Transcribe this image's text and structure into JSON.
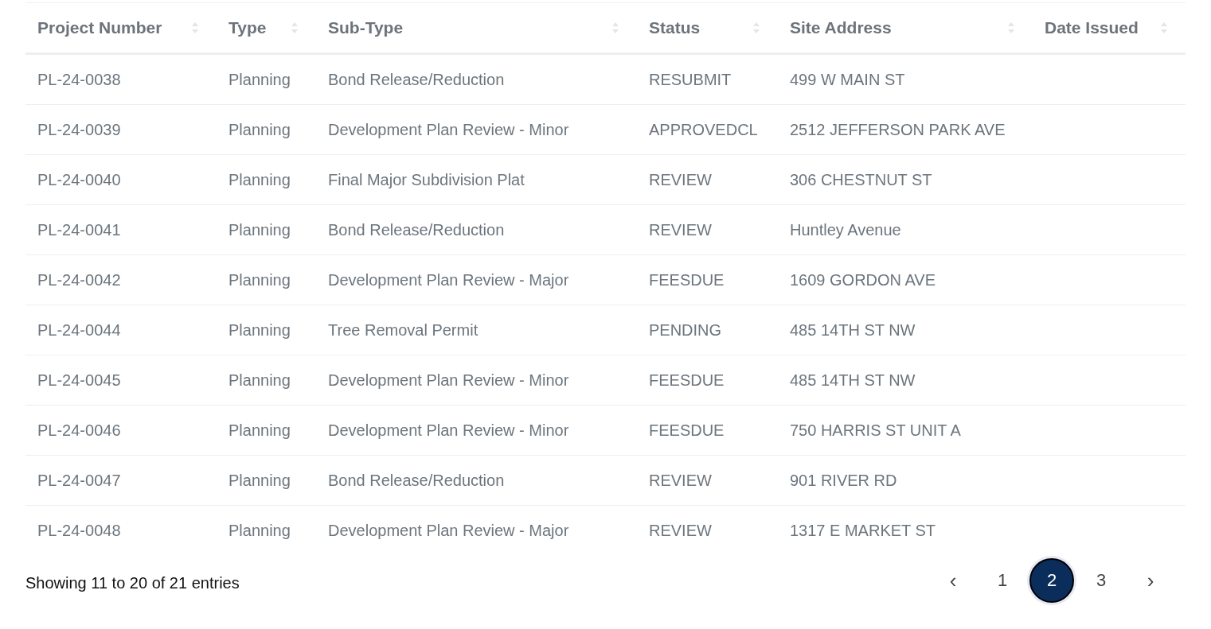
{
  "table": {
    "columns": [
      {
        "label": "Project Number",
        "sortable": true
      },
      {
        "label": "Type",
        "sortable": true
      },
      {
        "label": "Sub-Type",
        "sortable": true
      },
      {
        "label": "Status",
        "sortable": true
      },
      {
        "label": "Site Address",
        "sortable": true
      },
      {
        "label": "Date Issued",
        "sortable": true
      }
    ],
    "rows": [
      [
        "PL-24-0038",
        "Planning",
        "Bond Release/Reduction",
        "RESUBMIT",
        "499 W MAIN ST"
      ],
      [
        "PL-24-0039",
        "Planning",
        "Development Plan Review - Minor",
        "APPROVEDCL",
        "2512 JEFFERSON PARK AVE"
      ],
      [
        "PL-24-0040",
        "Planning",
        "Final Major Subdivision Plat",
        "REVIEW",
        "306 CHESTNUT ST"
      ],
      [
        "PL-24-0041",
        "Planning",
        "Bond Release/Reduction",
        "REVIEW",
        "Huntley Avenue"
      ],
      [
        "PL-24-0042",
        "Planning",
        "Development Plan Review - Major",
        "FEESDUE",
        "1609 GORDON AVE"
      ],
      [
        "PL-24-0044",
        "Planning",
        "Tree Removal Permit",
        "PENDING",
        "485 14TH ST NW"
      ],
      [
        "PL-24-0045",
        "Planning",
        "Development Plan Review - Minor",
        "FEESDUE",
        "485 14TH ST NW"
      ],
      [
        "PL-24-0046",
        "Planning",
        "Development Plan Review - Minor",
        "FEESDUE",
        "750 HARRIS ST UNIT A"
      ],
      [
        "PL-24-0047",
        "Planning",
        "Bond Release/Reduction",
        "REVIEW",
        "901 RIVER RD"
      ],
      [
        "PL-24-0048",
        "Planning",
        "Development Plan Review - Major",
        "REVIEW",
        "1317 E MARKET ST"
      ]
    ]
  },
  "footer": {
    "info": "Showing 11 to 20 of 21 entries",
    "pagination": {
      "previous": "‹",
      "next": "›",
      "pages": [
        {
          "label": "1",
          "selected": false
        },
        {
          "label": "2",
          "selected": true
        },
        {
          "label": "3",
          "selected": false
        }
      ]
    }
  }
}
